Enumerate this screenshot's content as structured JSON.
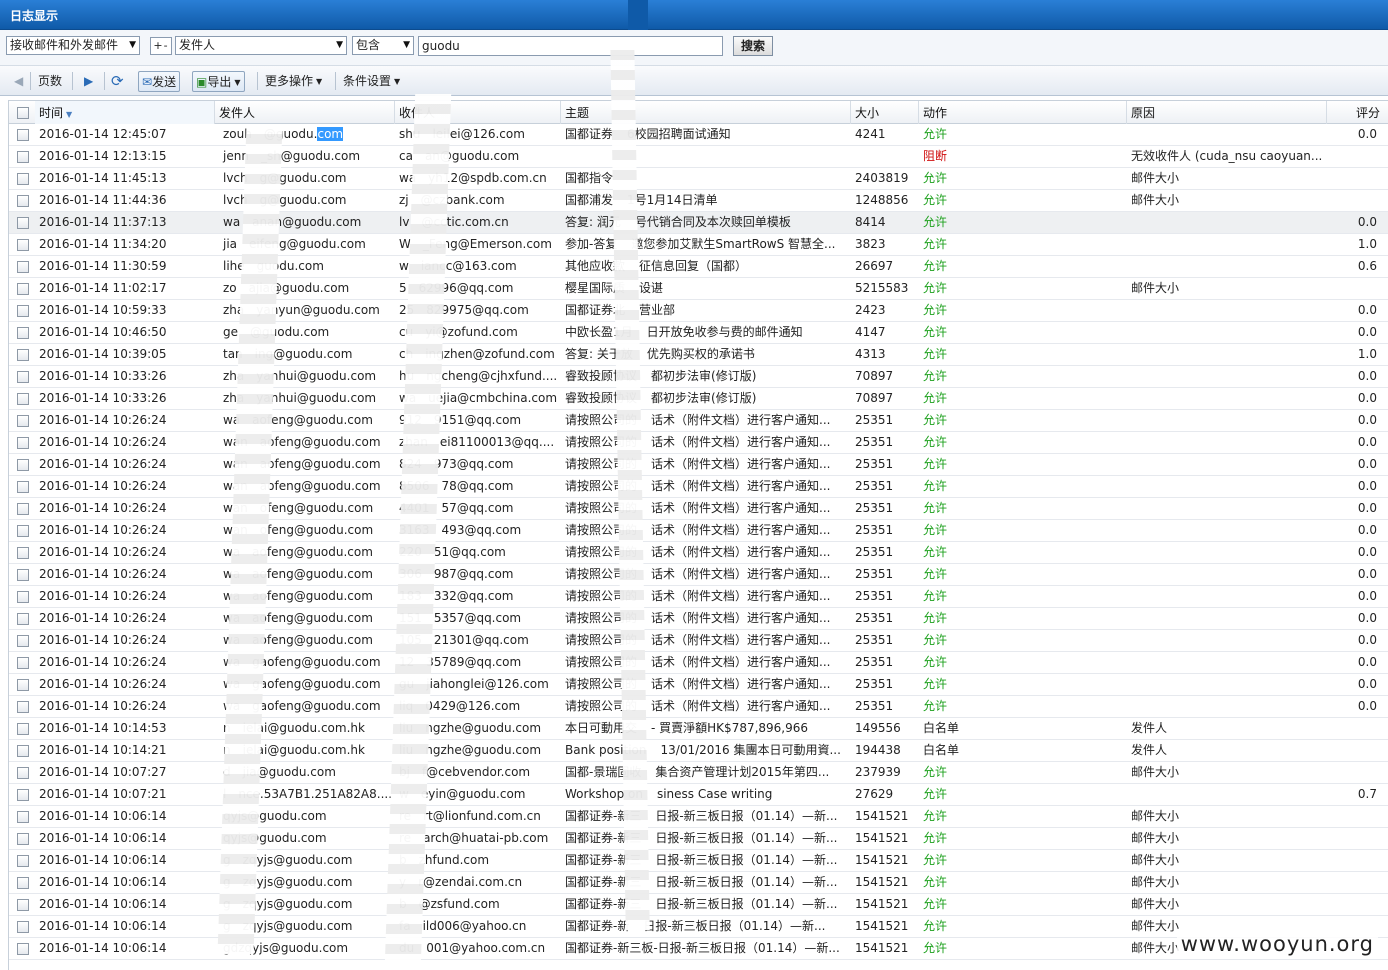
{
  "window": {
    "title": "日志显示"
  },
  "filters": {
    "mail_scope": "接收邮件和外发邮件",
    "toggle": "+-",
    "field": "发件人",
    "operator": "包含",
    "keyword": "guodu",
    "search_label": "搜索"
  },
  "toolbar": {
    "pages_label": "页数",
    "send_label": "发送",
    "export_label": "导出",
    "more_label": "更多操作",
    "cond_label": "条件设置"
  },
  "columns": [
    "时间",
    "发件人",
    "收件人",
    "主题",
    "大小",
    "动作",
    "原因",
    "评分"
  ],
  "rows": [
    {
      "time": "2016-01-14 12:45:07",
      "from": "zouh",
      "from_b": "@guodu.",
      "from_hl": "com",
      "to": "shu",
      "to_b": "leilei@126.com",
      "subject": "国都证券",
      "subject_b": "6校园招聘面试通知",
      "size": "4241",
      "action": "允许",
      "act": "allow",
      "reason": "",
      "score": "0.0"
    },
    {
      "time": "2016-01-14 12:13:15",
      "from": "jenn",
      "from_b": "_sh@guodu.com",
      "from_hl": "",
      "to": "ca",
      "to_b": "an@guodu.com",
      "subject": "",
      "subject_b": "",
      "size": "",
      "action": "阻断",
      "act": "block",
      "reason": "无效收件人 (cuda_nsu caoyuan...",
      "score": ""
    },
    {
      "time": "2016-01-14 11:45:13",
      "from": "lvch",
      "from_b": "g@guodu.com",
      "from_hl": "",
      "to": "wa",
      "to_b": "yh12@spdb.com.cn",
      "subject": "国都指令",
      "subject_b": "",
      "size": "2403819",
      "action": "允许",
      "act": "allow",
      "reason": "邮件大小",
      "score": ""
    },
    {
      "time": "2016-01-14 11:44:36",
      "from": "lvch",
      "from_b": "g@guodu.com",
      "from_hl": "",
      "to": "zj",
      "to_b": "@czbank.com",
      "subject": "国都浦发",
      "subject_b": "1号1月14日清单",
      "size": "1248856",
      "action": "允许",
      "act": "allow",
      "reason": "邮件大小",
      "score": ""
    },
    {
      "time": "2016-01-14 11:37:13",
      "from": "wa",
      "from_b": "anan@guodu.com",
      "from_hl": "",
      "to": "lv",
      "to_b": "@cctic.com.cn",
      "subject": "答复: 润元",
      "subject_b": "号代销合同及本次赎回单模板",
      "size": "8414",
      "action": "允许",
      "act": "allow",
      "reason": "",
      "score": "0.0",
      "hl": true
    },
    {
      "time": "2016-01-14 11:34:20",
      "from": "jia",
      "from_b": "eifeng@guodu.com",
      "from_hl": "",
      "to": "W",
      "to_b": "_Feng@Emerson.com",
      "subject": "参加-答复",
      "subject_b": "邀您参加艾默生SmartRowS 智慧全...",
      "size": "3823",
      "action": "允许",
      "act": "allow",
      "reason": "",
      "score": "1.0"
    },
    {
      "time": "2016-01-14 11:30:59",
      "from": "lihe",
      "from_b": "guodu.com",
      "from_hl": "",
      "to": "w",
      "to_b": "iancc@163.com",
      "subject": "其他应收款",
      "subject_b": "征信息回复（国都）",
      "size": "26697",
      "action": "允许",
      "act": "allow",
      "reason": "",
      "score": "0.6"
    },
    {
      "time": "2016-01-14 11:02:17",
      "from": "zo",
      "from_b": "ajia@guodu.com",
      "from_hl": "",
      "to": "5",
      "to_b": "62996@qq.com",
      "subject": "樱星国际质",
      "subject_b": "设谌",
      "size": "5215583",
      "action": "允许",
      "act": "allow",
      "reason": "邮件大小",
      "score": ""
    },
    {
      "time": "2016-01-14 10:59:33",
      "from": "zha",
      "from_b": "yanyun@guodu.com",
      "from_hl": "",
      "to": "25",
      "to_b": "829975@qq.com",
      "subject": "国都证券北",
      "subject_b": "营业部",
      "size": "2423",
      "action": "允许",
      "act": "allow",
      "reason": "",
      "score": "0.0"
    },
    {
      "time": "2016-01-14 10:46:50",
      "from": "ge",
      "from_b": "@guodu.com",
      "from_hl": "",
      "to": "cu",
      "to_b": "yi@zofund.com",
      "subject": "中欧长盈1月",
      "subject_b": "日开放免收参与费的邮件通知",
      "size": "4147",
      "action": "允许",
      "act": "allow",
      "reason": "",
      "score": "0.0"
    },
    {
      "time": "2016-01-14 10:39:05",
      "from": "tan",
      "from_b": "ing@guodu.com",
      "from_hl": "",
      "to": "ch",
      "to_b": "ingzhen@zofund.com",
      "subject": "答复: 关于放",
      "subject_b": "优先购买权的承诺书",
      "size": "4313",
      "action": "允许",
      "act": "allow",
      "reason": "",
      "score": "1.0"
    },
    {
      "time": "2016-01-14 10:33:26",
      "from": "zha",
      "from_b": "yanhui@guodu.com",
      "from_hl": "",
      "to": "hu",
      "to_b": "ngcheng@cjhxfund....",
      "subject": "睿致投顾协议",
      "subject_b": "都初步法审(修订版)",
      "size": "70897",
      "action": "允许",
      "act": "allow",
      "reason": "",
      "score": "0.0"
    },
    {
      "time": "2016-01-14 10:33:26",
      "from": "zha",
      "from_b": "yanhui@guodu.com",
      "from_hl": "",
      "to": "wa",
      "to_b": "uejia@cmbchina.com",
      "subject": "睿致投顾协议",
      "subject_b": "都初步法审(修订版)",
      "size": "70897",
      "action": "允许",
      "act": "allow",
      "reason": "",
      "score": "0.0"
    },
    {
      "time": "2016-01-14 10:26:24",
      "from": "wa",
      "from_b": "aofeng@guodu.com",
      "from_hl": "",
      "to": "912",
      "to_b": "9151@qq.com",
      "subject": "请按照公司的",
      "subject_b": "话术（附件文档）进行客户通知...",
      "size": "25351",
      "action": "允许",
      "act": "allow",
      "reason": "",
      "score": "0.0"
    },
    {
      "time": "2016-01-14 10:26:24",
      "from": "wan",
      "from_b": "aofeng@guodu.com",
      "from_hl": "",
      "to": "zhan",
      "to_b": "ei81100013@qq....",
      "subject": "请按照公司的",
      "subject_b": "话术（附件文档）进行客户通知...",
      "size": "25351",
      "action": "允许",
      "act": "allow",
      "reason": "",
      "score": "0.0"
    },
    {
      "time": "2016-01-14 10:26:24",
      "from": "wan",
      "from_b": "aofeng@guodu.com",
      "from_hl": "",
      "to": "824",
      "to_b": "973@qq.com",
      "subject": "请按照公司的",
      "subject_b": "话术（附件文档）进行客户通知...",
      "size": "25351",
      "action": "允许",
      "act": "allow",
      "reason": "",
      "score": "0.0"
    },
    {
      "time": "2016-01-14 10:26:24",
      "from": "wan",
      "from_b": "aofeng@guodu.com",
      "from_hl": "",
      "to": "8506",
      "to_b": "78@qq.com",
      "subject": "请按照公司的",
      "subject_b": "话术（附件文档）进行客户通知...",
      "size": "25351",
      "action": "允许",
      "act": "allow",
      "reason": "",
      "score": "0.0"
    },
    {
      "time": "2016-01-14 10:26:24",
      "from": "wan",
      "from_b": "ofeng@guodu.com",
      "from_hl": "",
      "to": "4401",
      "to_b": "57@qq.com",
      "subject": "请按照公司的",
      "subject_b": "话术（附件文档）进行客户通知...",
      "size": "25351",
      "action": "允许",
      "act": "allow",
      "reason": "",
      "score": "0.0"
    },
    {
      "time": "2016-01-14 10:26:24",
      "from": "wan",
      "from_b": "ofeng@guodu.com",
      "from_hl": "",
      "to": "3163",
      "to_b": "493@qq.com",
      "subject": "请按照公司的",
      "subject_b": "话术（附件文档）进行客户通知...",
      "size": "25351",
      "action": "允许",
      "act": "allow",
      "reason": "",
      "score": "0.0"
    },
    {
      "time": "2016-01-14 10:26:24",
      "from": "wa",
      "from_b": "aofeng@guodu.com",
      "from_hl": "",
      "to": "220",
      "to_b": "51@qq.com",
      "subject": "请按照公司的",
      "subject_b": "话术（附件文档）进行客户通知...",
      "size": "25351",
      "action": "允许",
      "act": "allow",
      "reason": "",
      "score": "0.0"
    },
    {
      "time": "2016-01-14 10:26:24",
      "from": "wa",
      "from_b": "aofeng@guodu.com",
      "from_hl": "",
      "to": "306",
      "to_b": "987@qq.com",
      "subject": "请按照公司的",
      "subject_b": "话术（附件文档）进行客户通知...",
      "size": "25351",
      "action": "允许",
      "act": "allow",
      "reason": "",
      "score": "0.0"
    },
    {
      "time": "2016-01-14 10:26:24",
      "from": "wa",
      "from_b": "aofeng@guodu.com",
      "from_hl": "",
      "to": "183",
      "to_b": "332@qq.com",
      "subject": "请按照公司的",
      "subject_b": "话术（附件文档）进行客户通知...",
      "size": "25351",
      "action": "允许",
      "act": "allow",
      "reason": "",
      "score": "0.0"
    },
    {
      "time": "2016-01-14 10:26:24",
      "from": "wa",
      "from_b": "aofeng@guodu.com",
      "from_hl": "",
      "to": "151",
      "to_b": "5357@qq.com",
      "subject": "请按照公司的",
      "subject_b": "话术（附件文档）进行客户通知...",
      "size": "25351",
      "action": "允许",
      "act": "allow",
      "reason": "",
      "score": "0.0"
    },
    {
      "time": "2016-01-14 10:26:24",
      "from": "wa",
      "from_b": "aofeng@guodu.com",
      "from_hl": "",
      "to": "105",
      "to_b": "21301@qq.com",
      "subject": "请按照公司的",
      "subject_b": "话术（附件文档）进行客户通知...",
      "size": "25351",
      "action": "允许",
      "act": "allow",
      "reason": "",
      "score": "0.0"
    },
    {
      "time": "2016-01-14 10:26:24",
      "from": "wa",
      "from_b": "gaofeng@guodu.com",
      "from_hl": "",
      "to": "12",
      "to_b": "35789@qq.com",
      "subject": "请按照公司的",
      "subject_b": "话术（附件文档）进行客户通知...",
      "size": "25351",
      "action": "允许",
      "act": "allow",
      "reason": "",
      "score": "0.0"
    },
    {
      "time": "2016-01-14 10:26:24",
      "from": "wa",
      "from_b": "gaofeng@guodu.com",
      "from_hl": "",
      "to": "gu",
      "to_b": "jiahonglei@126.com",
      "subject": "请按照公司的",
      "subject_b": "话术（附件文档）进行客户通知...",
      "size": "25351",
      "action": "允许",
      "act": "allow",
      "reason": "",
      "score": "0.0"
    },
    {
      "time": "2016-01-14 10:26:24",
      "from": "wa",
      "from_b": "gaofeng@guodu.com",
      "from_hl": "",
      "to": "liq",
      "to_b": "0429@126.com",
      "subject": "请按照公司的",
      "subject_b": "话术（附件文档）进行客户通知...",
      "size": "25351",
      "action": "允许",
      "act": "allow",
      "reason": "",
      "score": "0.0"
    },
    {
      "time": "2016-01-14 10:14:53",
      "from": "n",
      "from_b": "ielai@guodu.com.hk",
      "from_hl": "",
      "to": "liu",
      "to_b": "ngzhe@guodu.com",
      "subject": "本日可動用交",
      "subject_b": "- 買賣淨額HK$787,896,966",
      "size": "149556",
      "action": "白名单",
      "act": "white",
      "reason": "发件人",
      "score": ""
    },
    {
      "time": "2016-01-14 10:14:21",
      "from": "n",
      "from_b": "ielai@guodu.com.hk",
      "from_hl": "",
      "to": "liu",
      "to_b": "ngzhe@guodu.com",
      "subject": "Bank position",
      "subject_b": "13/01/2016 集團本日可動用資...",
      "size": "194438",
      "action": "白名单",
      "act": "white",
      "reason": "发件人",
      "score": ""
    },
    {
      "time": "2016-01-14 10:07:27",
      "from": "d",
      "from_b": "jia@guodu.com",
      "from_hl": "",
      "to": "bj",
      "to_b": "f@cebvendor.com",
      "subject": "国都-景瑞固收",
      "subject_b": "集合资产管理计划2015年第四...",
      "size": "237939",
      "action": "允许",
      "act": "allow",
      "reason": "邮件大小",
      "score": ""
    },
    {
      "time": "2016-01-14 10:07:21",
      "from": "l",
      "from_b": "nce.53A7B1.251A82A8....",
      "from_hl": "",
      "to": "w",
      "to_b": "eyin@guodu.com",
      "subject": "Workshop on",
      "subject_b": "siness Case writing",
      "size": "27629",
      "action": "允许",
      "act": "allow",
      "reason": "",
      "score": "0.7"
    },
    {
      "time": "2016-01-14 10:06:14",
      "from": "",
      "from_b": "qyjs@guodu.com",
      "from_hl": "",
      "to": "re",
      "to_b": "rt@lionfund.com.cn",
      "subject": "国都证券-新三",
      "subject_b": "日报-新三板日报（01.14）—新...",
      "size": "1541521",
      "action": "允许",
      "act": "allow",
      "reason": "邮件大小",
      "score": ""
    },
    {
      "time": "2016-01-14 10:06:14",
      "from": "",
      "from_b": "qyjs@guodu.com",
      "from_hl": "",
      "to": "re",
      "to_b": "arch@huatai-pb.com",
      "subject": "国都证券-新三",
      "subject_b": "日报-新三板日报（01.14）—新...",
      "size": "1541521",
      "action": "允许",
      "act": "allow",
      "reason": "邮件大小",
      "score": ""
    },
    {
      "time": "2016-01-14 10:06:14",
      "from": "g",
      "from_b": "zqyjs@guodu.com",
      "from_hl": "",
      "to": "b",
      "to_b": "zhfund.com",
      "subject": "国都证券-新三",
      "subject_b": "日报-新三板日报（01.14）—新...",
      "size": "1541521",
      "action": "允许",
      "act": "allow",
      "reason": "邮件大小",
      "score": ""
    },
    {
      "time": "2016-01-14 10:06:14",
      "from": "g",
      "from_b": "zqyjs@guodu.com",
      "from_hl": "",
      "to": "y",
      "to_b": "r@zendai.com.cn",
      "subject": "国都证券-新三",
      "subject_b": "日报-新三板日报（01.14）—新...",
      "size": "1541521",
      "action": "允许",
      "act": "allow",
      "reason": "邮件大小",
      "score": ""
    },
    {
      "time": "2016-01-14 10:06:14",
      "from": "g",
      "from_b": "zqyjs@guodu.com",
      "from_hl": "",
      "to": "b",
      "to_b": "@zsfund.com",
      "subject": "国都证券-新三",
      "subject_b": "日报-新三板日报（01.14）—新...",
      "size": "1541521",
      "action": "允许",
      "act": "allow",
      "reason": "邮件大小",
      "score": ""
    },
    {
      "time": "2016-01-14 10:06:14",
      "from": "g",
      "from_b": "zqyjs@guodu.com",
      "from_hl": "",
      "to": "fa",
      "to_b": "ild006@yahoo.cn",
      "subject": "国都证券-新",
      "subject_b": "日报-新三板日报（01.14）—新...",
      "size": "1541521",
      "action": "允许",
      "act": "allow",
      "reason": "邮件大小",
      "score": ""
    },
    {
      "time": "2016-01-14 10:06:14",
      "from": "gdzqyjs@guodu.com",
      "from_b": "",
      "from_hl": "",
      "to": "du",
      "to_b": "001@yahoo.com.cn",
      "subject": "国都证券-新三板-日报-新三板日报（01.14）—新...",
      "subject_b": "",
      "size": "1541521",
      "action": "允许",
      "act": "allow",
      "reason": "邮件大小",
      "score": ""
    }
  ],
  "watermark": "www.wooyun.org",
  "colors": {
    "allow": "#1ca01c",
    "block": "#d01010",
    "titlebar": "#1a6cc4"
  }
}
